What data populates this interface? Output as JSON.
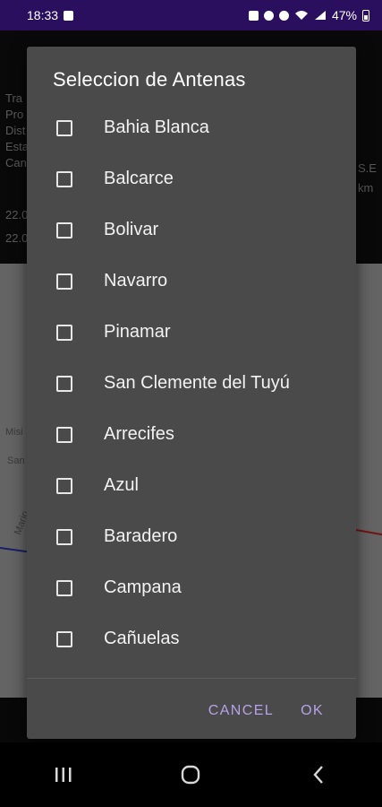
{
  "status_bar": {
    "time": "18:33",
    "battery": "47%",
    "icons": [
      "image-icon",
      "lock-icon",
      "alarm-icon",
      "location-icon",
      "wifi-icon",
      "signal-icon",
      "battery-icon"
    ]
  },
  "background": {
    "left_labels": [
      "Tra",
      "Pro",
      "Dist",
      "Esta",
      "Can"
    ],
    "right_labels": [
      "S.E",
      "km"
    ],
    "rows": [
      "22.0",
      "22.0"
    ],
    "map_labels": [
      "Misi",
      "San",
      "Mario"
    ]
  },
  "dialog": {
    "title": "Seleccion de Antenas",
    "items": [
      {
        "label": "Bahia Blanca",
        "checked": false
      },
      {
        "label": "Balcarce",
        "checked": false
      },
      {
        "label": "Bolivar",
        "checked": false
      },
      {
        "label": "Navarro",
        "checked": false
      },
      {
        "label": "Pinamar",
        "checked": false
      },
      {
        "label": "San Clemente del Tuyú",
        "checked": false
      },
      {
        "label": "Arrecifes",
        "checked": false
      },
      {
        "label": "Azul",
        "checked": false
      },
      {
        "label": "Baradero",
        "checked": false
      },
      {
        "label": "Campana",
        "checked": false
      },
      {
        "label": "Cañuelas",
        "checked": false
      }
    ],
    "cancel_label": "CANCEL",
    "ok_label": "OK"
  },
  "colors": {
    "accent": "#b6a2e8",
    "status_bar": "#2a0f5e",
    "dialog_bg": "#4a4a4a"
  }
}
